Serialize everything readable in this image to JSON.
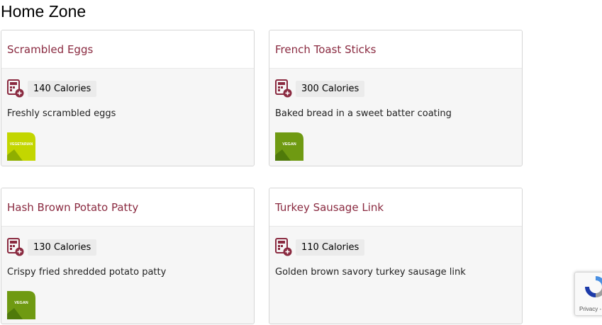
{
  "zone": {
    "title": "Home Zone"
  },
  "items": [
    {
      "name": "Scrambled Eggs",
      "calories": "140 Calories",
      "description": "Freshly scrambled eggs",
      "badge": "VEGETARIAN",
      "badge_color": "#c3d600",
      "badge_shade": "#8fae00"
    },
    {
      "name": "French Toast Sticks",
      "calories": "300 Calories",
      "description": "Baked bread in a sweet batter coating",
      "badge": "VEGAN",
      "badge_color": "#6f9a12",
      "badge_shade": "#4f7a0a"
    },
    {
      "name": "Hash Brown Potato Patty",
      "calories": "130 Calories",
      "description": "Crispy fried shredded potato patty",
      "badge": "VEGAN",
      "badge_color": "#6f9a12",
      "badge_shade": "#4f7a0a"
    },
    {
      "name": "Turkey Sausage Link",
      "calories": "110 Calories",
      "description": "Golden brown savory turkey sausage link"
    }
  ],
  "recaptcha": {
    "text": "Privacy -"
  },
  "colors": {
    "title": "#8a2a40",
    "calc_icon": "#8a2a40"
  }
}
